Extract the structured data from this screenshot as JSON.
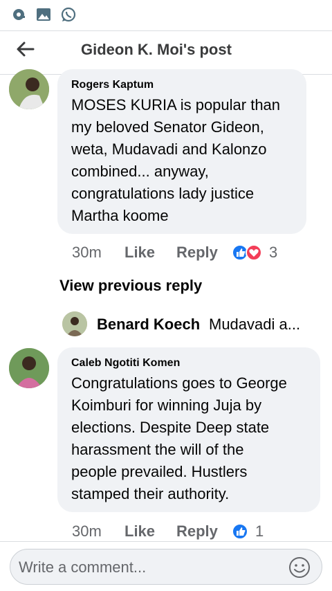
{
  "status_bar": {
    "icons": [
      "sync-icon",
      "gallery-icon",
      "whatsapp-icon"
    ]
  },
  "header": {
    "title": "Gideon K. Moi's post"
  },
  "comments": [
    {
      "author": "Rogers Kaptum",
      "text_lines": [
        "MOSES KURIA is popular than",
        "my beloved Senator Gideon,",
        "weta, Mudavadi and Kalonzo",
        "combined... anyway,",
        "congratulations lady justice",
        "Martha koome"
      ],
      "time": "30m",
      "like_label": "Like",
      "reply_label": "Reply",
      "reaction_count": "3",
      "reactions": [
        "like-icon",
        "love-icon"
      ]
    },
    {
      "author": "Caleb Ngotiti Komen",
      "text_lines": [
        "Congratulations goes to George",
        "Koimburi for winning Juja by",
        "elections. Despite Deep state",
        "harassment the will of the",
        "people prevailed. Hustlers",
        "stamped their authority."
      ],
      "time": "30m",
      "like_label": "Like",
      "reply_label": "Reply",
      "reaction_count": "1",
      "reactions": [
        "like-icon"
      ]
    }
  ],
  "view_previous_reply": "View previous reply",
  "reply_preview": {
    "author": "Benard Koech",
    "text": "Mudavadi a..."
  },
  "composer": {
    "placeholder": "Write a comment..."
  },
  "colors": {
    "like_blue": "#1877f2",
    "love_red": "#f33e58",
    "bubble": "#f0f2f5",
    "meta_gray": "#65676b"
  }
}
